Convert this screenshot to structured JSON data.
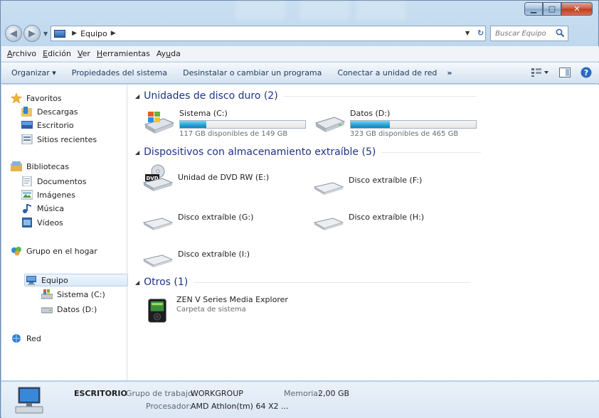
{
  "window": {
    "breadcrumb": [
      "Equipo"
    ]
  },
  "search": {
    "placeholder": "Buscar Equipo"
  },
  "menu": [
    {
      "accel": "A",
      "rest": "rchivo"
    },
    {
      "accel": "E",
      "rest": "dición"
    },
    {
      "accel": "V",
      "rest": "er"
    },
    {
      "accel": "H",
      "rest": "erramientas"
    },
    {
      "pre": "Ay",
      "accel": "u",
      "rest": "da"
    }
  ],
  "toolbar": {
    "organize": "Organizar ▾",
    "system_properties": "Propiedades del sistema",
    "uninstall": "Desinstalar o cambiar un programa",
    "map_drive": "Conectar a unidad de red",
    "more": "»"
  },
  "nav": {
    "favorites": "Favoritos",
    "downloads": "Descargas",
    "desktop": "Escritorio",
    "recent": "Sitios recientes",
    "libraries": "Bibliotecas",
    "documents": "Documentos",
    "images": "Imágenes",
    "music": "Música",
    "videos": "Vídeos",
    "homegroup": "Grupo en el hogar",
    "computer": "Equipo",
    "system_c": "Sistema (C:)",
    "data_d": "Datos (D:)",
    "network": "Red"
  },
  "groups": {
    "hdd": "Unidades de disco duro (2)",
    "removable": "Dispositivos con almacenamiento extraíble (5)",
    "others": "Otros (1)"
  },
  "hdd": [
    {
      "name": "Sistema (C:)",
      "free": "117 GB disponibles de 149 GB",
      "used_fraction": 0.21
    },
    {
      "name": "Datos (D:)",
      "free": "323 GB disponibles de 465 GB",
      "used_fraction": 0.31
    }
  ],
  "removable": {
    "dvd": "Unidad de DVD RW (E:)",
    "f": "Disco extraíble (F:)",
    "g": "Disco extraíble (G:)",
    "h": "Disco extraíble (H:)",
    "i": "Disco extraíble (I:)"
  },
  "others": {
    "name": "ZEN V Series Media Explorer",
    "sub": "Carpeta de sistema"
  },
  "details": {
    "computer_name": "ESCRITORIO",
    "workgroup_label": "Grupo de trabajo:",
    "workgroup_value": "WORKGROUP",
    "memory_label": "Memoria:",
    "memory_value": "2,00 GB",
    "processor_label": "Procesador:",
    "processor_value": "AMD Athlon(tm) 64 X2 ..."
  }
}
